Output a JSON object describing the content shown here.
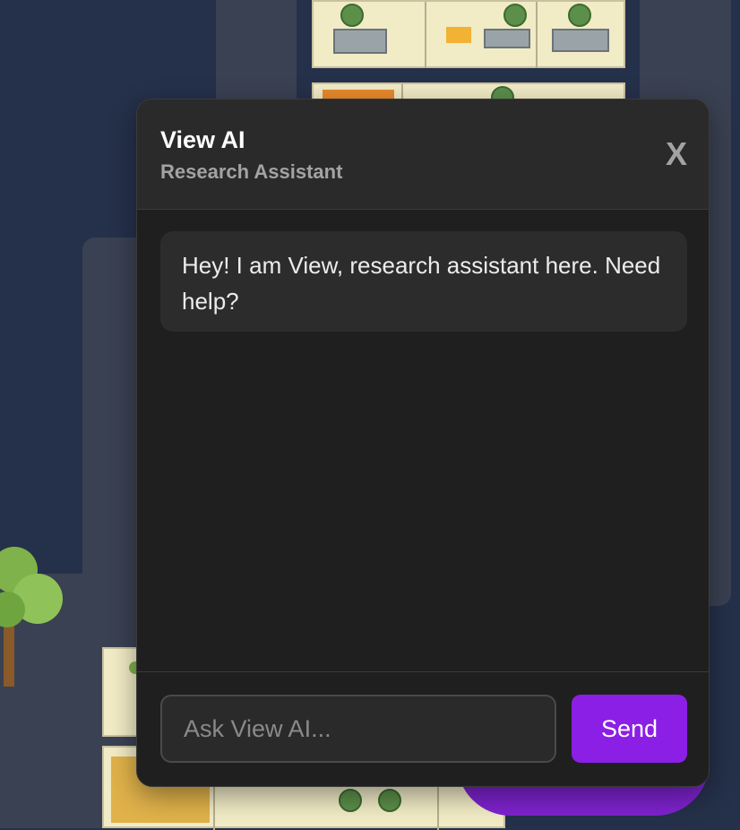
{
  "chat": {
    "title": "View AI",
    "subtitle": "Research Assistant",
    "close_label": "X",
    "messages": [
      {
        "role": "assistant",
        "text": "Hey! I am View, research assistant here. Need help?"
      }
    ],
    "input_placeholder": "Ask View AI...",
    "input_value": "",
    "send_label": "Send"
  },
  "colors": {
    "accent": "#8b1fe6",
    "panel_bg": "#1f1f1f",
    "header_bg": "#2a2a2a",
    "map_bg": "#25304a"
  }
}
